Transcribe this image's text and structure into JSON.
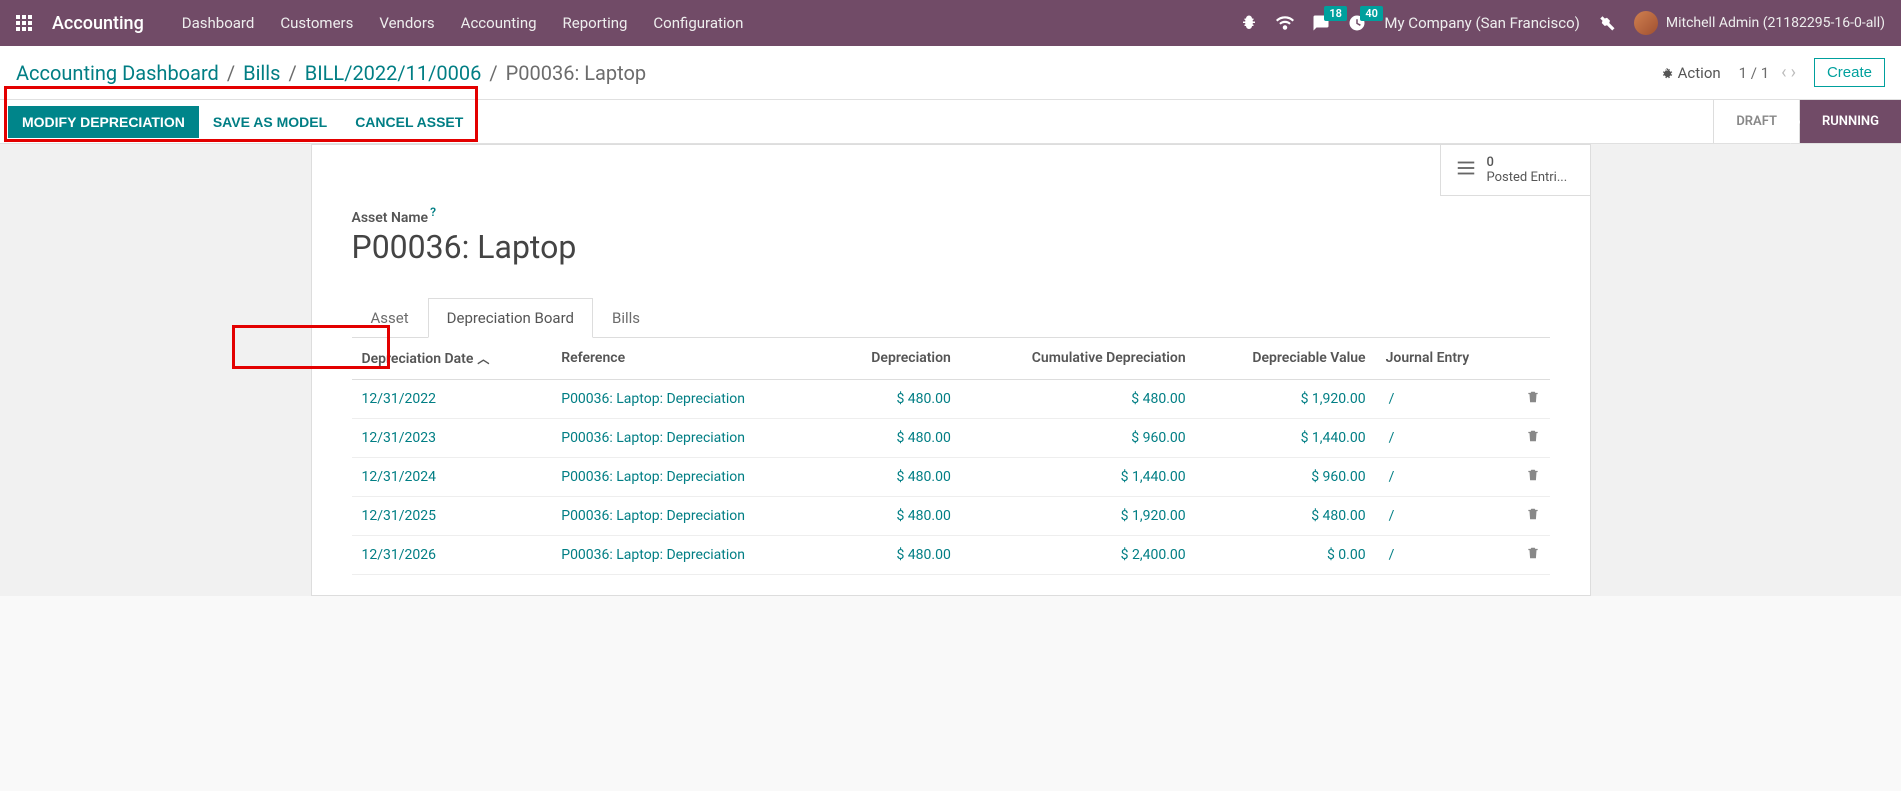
{
  "navbar": {
    "brand": "Accounting",
    "menu": [
      "Dashboard",
      "Customers",
      "Vendors",
      "Accounting",
      "Reporting",
      "Configuration"
    ],
    "messages_badge": "18",
    "activities_badge": "40",
    "company": "My Company (San Francisco)",
    "user": "Mitchell Admin (21182295-16-0-all)"
  },
  "breadcrumb": {
    "items": [
      "Accounting Dashboard",
      "Bills",
      "BILL/2022/11/0006"
    ],
    "current": "P00036: Laptop"
  },
  "controls": {
    "action_label": "Action",
    "pager": "1 / 1",
    "create_label": "Create"
  },
  "buttons": {
    "modify": "MODIFY DEPRECIATION",
    "save_model": "SAVE AS MODEL",
    "cancel": "CANCEL ASSET"
  },
  "stages": {
    "draft": "DRAFT",
    "running": "RUNNING"
  },
  "stat": {
    "count": "0",
    "label": "Posted Entri..."
  },
  "asset": {
    "label": "Asset Name",
    "help": "?",
    "name": "P00036: Laptop"
  },
  "tabs": {
    "asset": "Asset",
    "dep_board": "Depreciation Board",
    "bills": "Bills"
  },
  "table": {
    "headers": {
      "date": "Depreciation Date",
      "reference": "Reference",
      "depreciation": "Depreciation",
      "cumulative": "Cumulative Depreciation",
      "depreciable": "Depreciable Value",
      "journal": "Journal Entry"
    },
    "rows": [
      {
        "date": "12/31/2022",
        "reference": "P00036: Laptop: Depreciation",
        "dep": "$ 480.00",
        "cum": "$ 480.00",
        "val": "$ 1,920.00",
        "je": "/"
      },
      {
        "date": "12/31/2023",
        "reference": "P00036: Laptop: Depreciation",
        "dep": "$ 480.00",
        "cum": "$ 960.00",
        "val": "$ 1,440.00",
        "je": "/"
      },
      {
        "date": "12/31/2024",
        "reference": "P00036: Laptop: Depreciation",
        "dep": "$ 480.00",
        "cum": "$ 1,440.00",
        "val": "$ 960.00",
        "je": "/"
      },
      {
        "date": "12/31/2025",
        "reference": "P00036: Laptop: Depreciation",
        "dep": "$ 480.00",
        "cum": "$ 1,920.00",
        "val": "$ 480.00",
        "je": "/"
      },
      {
        "date": "12/31/2026",
        "reference": "P00036: Laptop: Depreciation",
        "dep": "$ 480.00",
        "cum": "$ 2,400.00",
        "val": "$ 0.00",
        "je": "/"
      }
    ]
  }
}
